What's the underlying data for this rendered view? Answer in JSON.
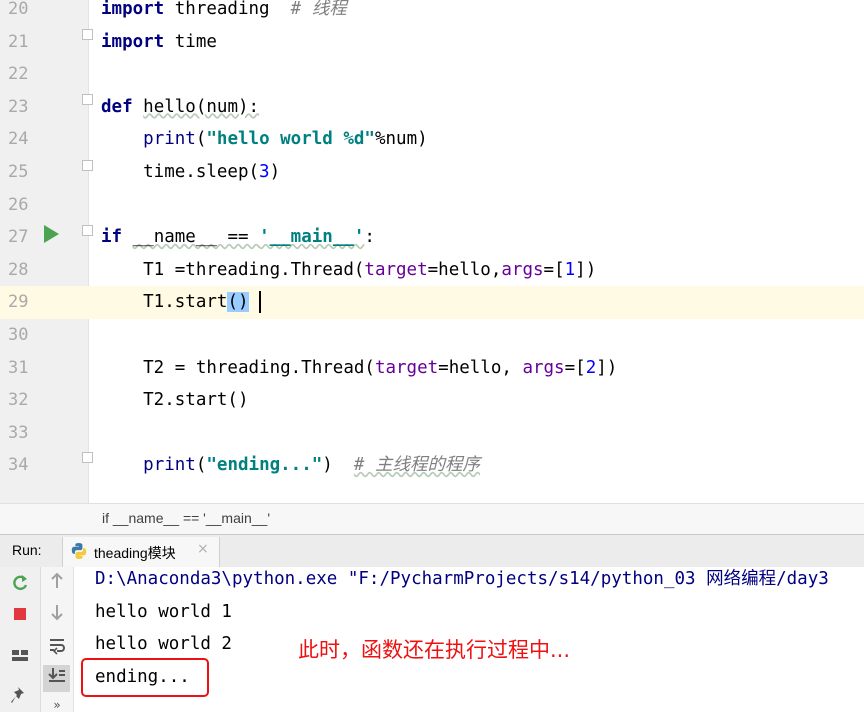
{
  "editor": {
    "lines": [
      {
        "num": "20",
        "tokens": [
          {
            "t": "import",
            "c": "kw"
          },
          {
            "t": " threading  "
          },
          {
            "t": "# 线程",
            "c": "cm"
          }
        ]
      },
      {
        "num": "21",
        "tokens": [
          {
            "t": "import",
            "c": "kw"
          },
          {
            "t": " time"
          }
        ]
      },
      {
        "num": "22",
        "tokens": []
      },
      {
        "num": "23",
        "tokens": [
          {
            "t": "def",
            "c": "kw"
          },
          {
            "t": " "
          },
          {
            "t": "hello(num):",
            "c": "squig"
          }
        ]
      },
      {
        "num": "24",
        "tokens": [
          {
            "t": "    "
          },
          {
            "t": "print",
            "c": "fn"
          },
          {
            "t": "("
          },
          {
            "t": "\"hello world %d\"",
            "c": "str"
          },
          {
            "t": "%num)"
          }
        ]
      },
      {
        "num": "25",
        "tokens": [
          {
            "t": "    time.sleep("
          },
          {
            "t": "3",
            "c": "num"
          },
          {
            "t": ")"
          }
        ]
      },
      {
        "num": "26",
        "tokens": []
      },
      {
        "num": "27",
        "tokens": [
          {
            "t": "if",
            "c": "kw"
          },
          {
            "t": " "
          },
          {
            "t": "__name__ == ",
            "c": "squig"
          },
          {
            "t": "'__main__'",
            "c": "str squig"
          },
          {
            "t": ":"
          }
        ]
      },
      {
        "num": "28",
        "tokens": [
          {
            "t": "    T1 =threading.Thread("
          },
          {
            "t": "target",
            "c": "param"
          },
          {
            "t": "=hello,"
          },
          {
            "t": "args",
            "c": "param"
          },
          {
            "t": "=["
          },
          {
            "t": "1",
            "c": "num"
          },
          {
            "t": "])"
          }
        ]
      },
      {
        "num": "29",
        "tokens": [
          {
            "t": "    T1.start"
          },
          {
            "t": "()",
            "c": "hl-paren"
          }
        ],
        "caret": true
      },
      {
        "num": "30",
        "tokens": []
      },
      {
        "num": "31",
        "tokens": [
          {
            "t": "    T2 = threading.Thread("
          },
          {
            "t": "target",
            "c": "param"
          },
          {
            "t": "=hello, "
          },
          {
            "t": "args",
            "c": "param"
          },
          {
            "t": "=["
          },
          {
            "t": "2",
            "c": "num"
          },
          {
            "t": "])"
          }
        ]
      },
      {
        "num": "32",
        "tokens": [
          {
            "t": "    T2.start()"
          }
        ]
      },
      {
        "num": "33",
        "tokens": []
      },
      {
        "num": "34",
        "tokens": [
          {
            "t": "    "
          },
          {
            "t": "print",
            "c": "fn"
          },
          {
            "t": "("
          },
          {
            "t": "\"ending...\"",
            "c": "str"
          },
          {
            "t": ")  "
          },
          {
            "t": "# 主线程的程序",
            "c": "cm squig"
          }
        ]
      }
    ]
  },
  "breadcrumb": "if __name__ == '__main__'",
  "run_panel": {
    "label": "Run:",
    "tab_label": "theading模块",
    "tab_close": "×",
    "icons": {
      "tab": "python-icon",
      "rerun": "rerun-icon",
      "stop": "stop-icon",
      "up": "arrow-up-icon",
      "down": "arrow-down-icon",
      "wrap": "soft-wrap-icon",
      "layout": "layout-icon",
      "scroll": "scroll-to-end-icon",
      "pin": "pin-icon",
      "more": "more-icon"
    },
    "console_lines": [
      "D:\\Anaconda3\\python.exe \"F:/PycharmProjects/s14/python_03 网络编程/day3",
      "hello world 1",
      "hello world 2",
      "ending..."
    ]
  },
  "annotation": "此时，函数还在执行过程中...",
  "colors": {
    "annotation": "#ee1111",
    "run_arrow": "#4ca352",
    "keyword": "#000080",
    "string": "#008080"
  }
}
